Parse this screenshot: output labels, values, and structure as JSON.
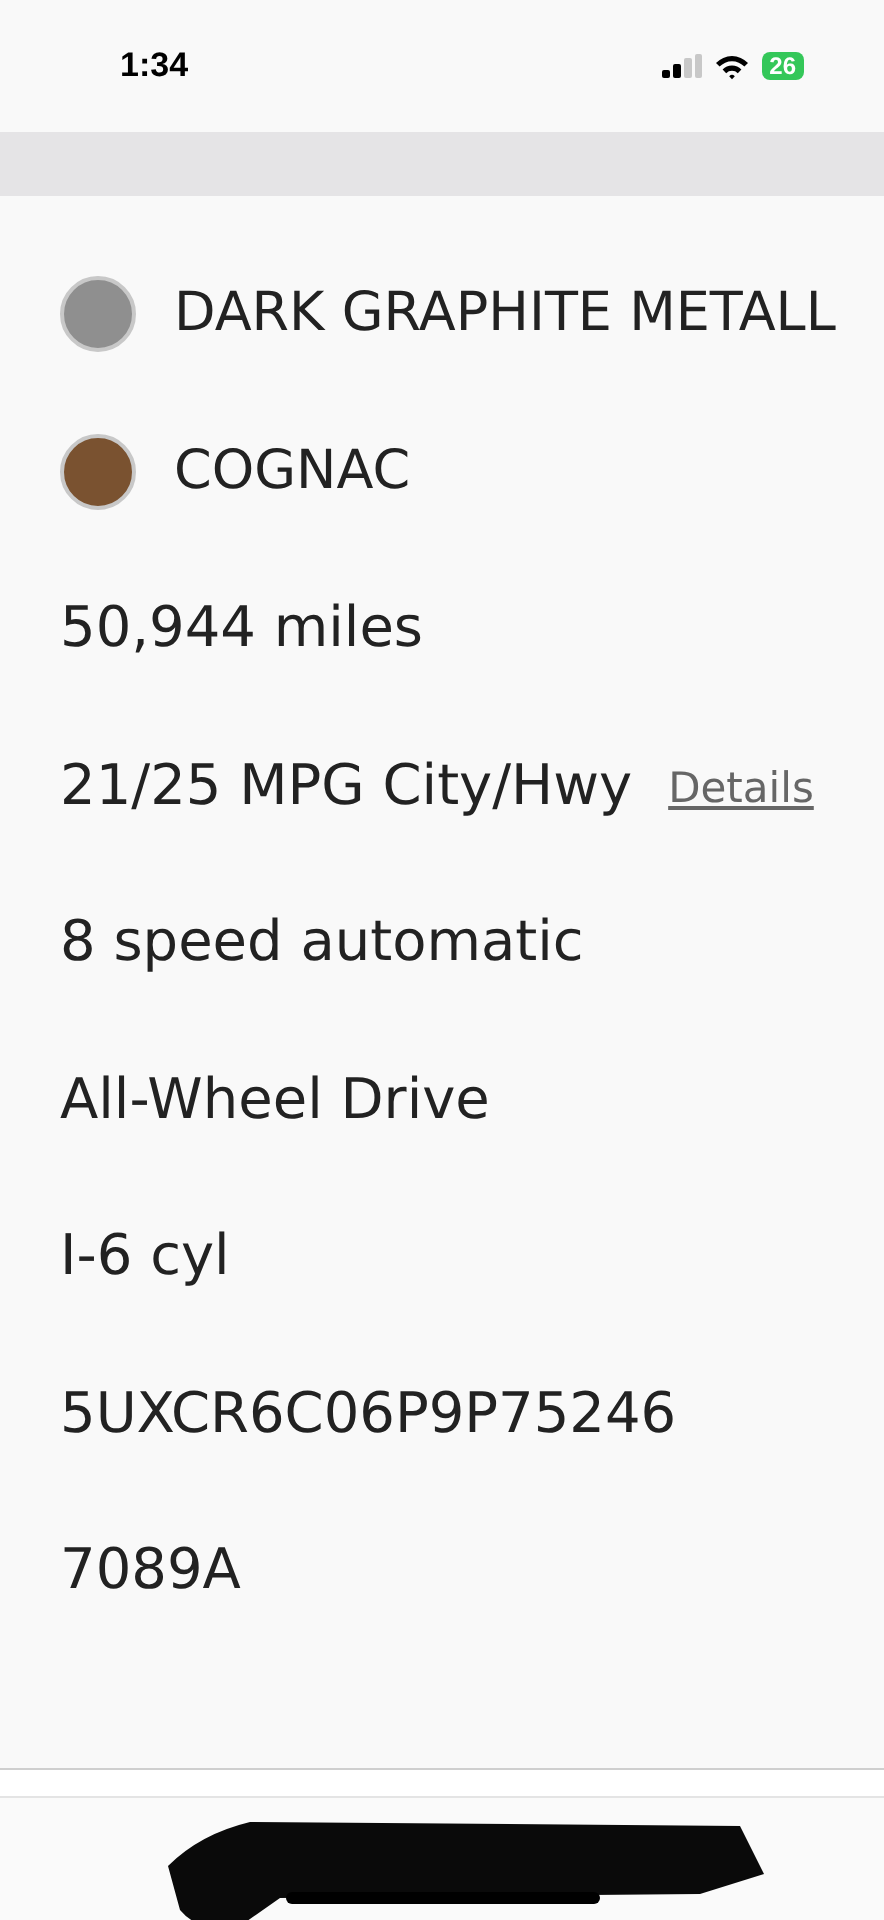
{
  "status_bar": {
    "time": "1:34",
    "battery": "26"
  },
  "specs": [
    {
      "kind": "swatch",
      "label": "DARK GRAPHITE METALL",
      "color": "#8f8f8f"
    },
    {
      "kind": "swatch",
      "label": "COGNAC",
      "color": "#7a5230"
    },
    {
      "kind": "text",
      "label": "50,944 miles"
    },
    {
      "kind": "link",
      "label": "21/25 MPG City/Hwy",
      "link": "Details"
    },
    {
      "kind": "text",
      "label": "8 speed automatic"
    },
    {
      "kind": "text",
      "label": "All-Wheel Drive"
    },
    {
      "kind": "text",
      "label": "I-6 cyl"
    },
    {
      "kind": "text",
      "label": "5UXCR6C06P9P75246"
    },
    {
      "kind": "text",
      "label": "7089A"
    }
  ]
}
